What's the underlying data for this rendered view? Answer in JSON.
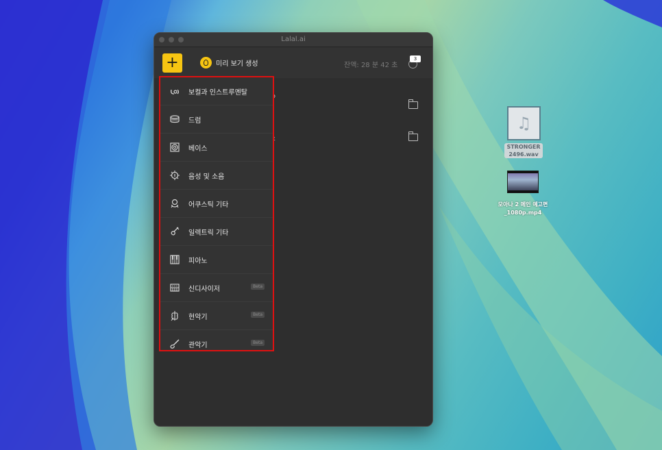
{
  "window": {
    "title": "Lalal.ai"
  },
  "toolbar": {
    "add_label": "+",
    "preview_label": "미리 보기 생성",
    "remaining": "잔액: 28 분 42 초",
    "queue_count": "3"
  },
  "background_peek": {
    "a": "ɔ",
    "b": "ɛ"
  },
  "menu": {
    "items": [
      {
        "label": "보컬과 인스트루멘탈",
        "icon": "vocal-icon",
        "beta": ""
      },
      {
        "label": "드럼",
        "icon": "drum-icon",
        "beta": ""
      },
      {
        "label": "베이스",
        "icon": "bass-speaker-icon",
        "beta": ""
      },
      {
        "label": "음성 및 소음",
        "icon": "voice-noise-icon",
        "beta": ""
      },
      {
        "label": "어쿠스틱 기타",
        "icon": "acoustic-guitar-icon",
        "beta": ""
      },
      {
        "label": "일렉트릭 기타",
        "icon": "electric-guitar-icon",
        "beta": ""
      },
      {
        "label": "피아노",
        "icon": "piano-icon",
        "beta": ""
      },
      {
        "label": "신디사이저",
        "icon": "synthesizer-icon",
        "beta": "Beta"
      },
      {
        "label": "현악기",
        "icon": "strings-icon",
        "beta": "Beta"
      },
      {
        "label": "관악기",
        "icon": "wind-instrument-icon",
        "beta": "Beta"
      }
    ]
  },
  "desktop": {
    "wav_line1": "STRONGER",
    "wav_line2": "2496.wav",
    "mp4_line1": "모아나 2 메인 예고편",
    "mp4_line2": "_1080p.mp4"
  }
}
